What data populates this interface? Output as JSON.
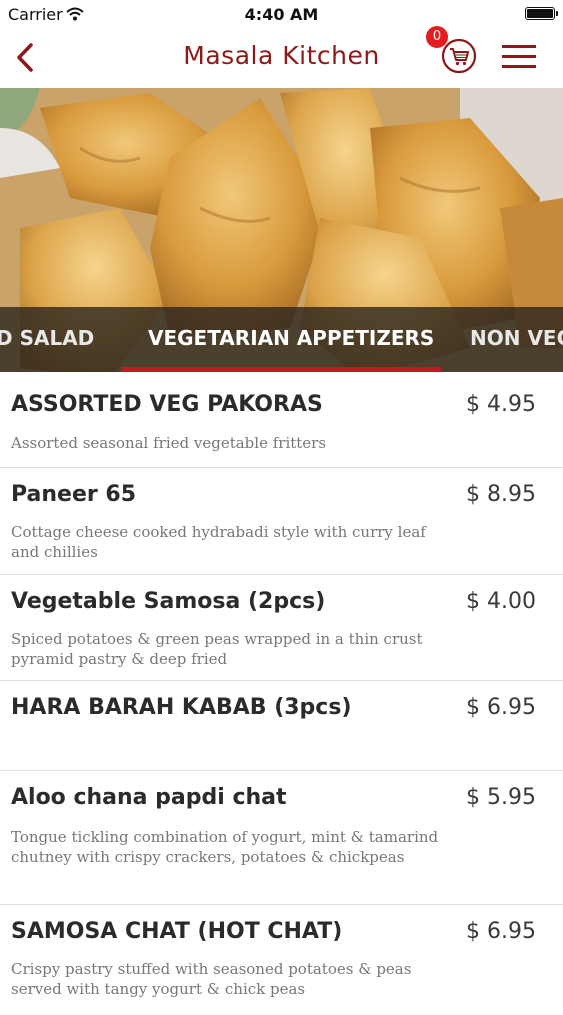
{
  "status_bar": {
    "carrier": "Carrier",
    "time": "4:40 AM"
  },
  "nav": {
    "title": "Masala Kitchen",
    "cart_count": "0"
  },
  "categories": {
    "prev": "D SALAD",
    "active": "VEGETARIAN APPETIZERS",
    "next": "NON VEG"
  },
  "menu_items": [
    {
      "name": "ASSORTED VEG PAKORAS",
      "price": "$ 4.95",
      "description": "Assorted seasonal fried vegetable fritters"
    },
    {
      "name": "Paneer 65",
      "price": "$ 8.95",
      "description": "Cottage cheese cooked hydrabadi style with curry leaf and chillies"
    },
    {
      "name": "Vegetable Samosa (2pcs)",
      "price": "$ 4.00",
      "description": "Spiced potatoes & green peas wrapped in a thin crust pyramid pastry & deep fried"
    },
    {
      "name": "HARA BARAH KABAB (3pcs)",
      "price": "$ 6.95",
      "description": ""
    },
    {
      "name": "Aloo chana papdi chat",
      "price": "$ 5.95",
      "description": "Tongue tickling combination of yogurt, mint & tamarind chutney with crispy crackers, potatoes & chickpeas"
    },
    {
      "name": "SAMOSA CHAT (HOT CHAT)",
      "price": "$ 6.95",
      "description": "Crispy pastry stuffed with seasoned potatoes & peas served with tangy yogurt & chick peas"
    }
  ],
  "colors": {
    "brand": "#8b1a1a",
    "accent": "#c0191f",
    "badge": "#e41e1e"
  },
  "icons": {
    "back": "chevron-left-icon",
    "cart": "shopping-cart-icon",
    "menu": "hamburger-menu-icon",
    "wifi": "wifi-icon",
    "battery": "battery-icon"
  }
}
